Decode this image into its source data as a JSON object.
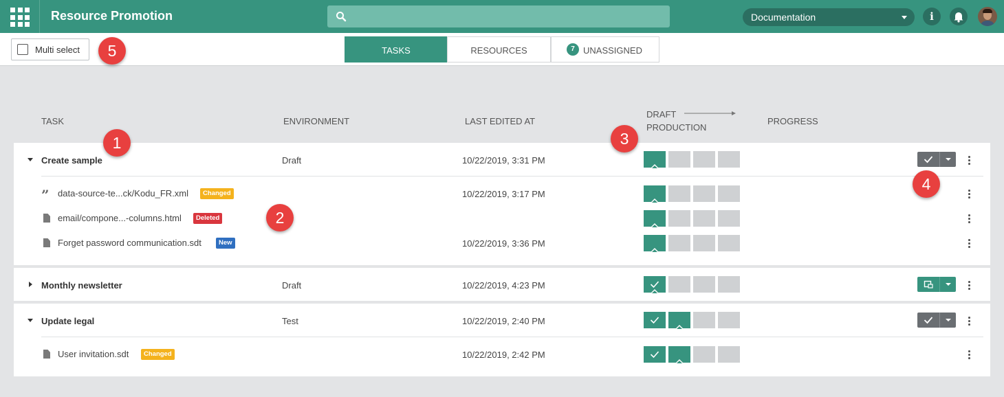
{
  "app": {
    "title": "Resource Promotion"
  },
  "header": {
    "environment_select": "Documentation",
    "info_glyph": "i",
    "icons": [
      "apps-grid-icon",
      "search-icon",
      "info-icon",
      "bell-icon",
      "avatar"
    ]
  },
  "toolbar": {
    "multi_select_label": "Multi select",
    "tabs": [
      {
        "label": "TASKS",
        "active": true
      },
      {
        "label": "RESOURCES",
        "active": false
      },
      {
        "label": "UNASSIGNED",
        "count": "7",
        "active": false
      }
    ]
  },
  "columns": {
    "task": "TASK",
    "environment": "ENVIRONMENT",
    "last_edited": "LAST EDITED AT",
    "stage_from": "DRAFT",
    "stage_to": "PRODUCTION",
    "progress": "PROGRESS"
  },
  "tasks": [
    {
      "name": "Create sample",
      "expanded": true,
      "environment": "Draft",
      "last_edited": "10/22/2019, 3:31 PM",
      "stages": [
        "current",
        "off",
        "off",
        "off"
      ],
      "action": "check-icon",
      "resources": [
        {
          "name": "data-source-te...ck/Kodu_FR.xml",
          "icon": "quote-icon",
          "badge": "Changed",
          "badge_type": "changed",
          "last_edited": "10/22/2019, 3:17 PM",
          "stages": [
            "current",
            "off",
            "off",
            "off"
          ]
        },
        {
          "name": "email/compone...-columns.html",
          "icon": "file-icon",
          "badge": "Deleted",
          "badge_type": "deleted",
          "last_edited": "",
          "stages": [
            "current",
            "off",
            "off",
            "off"
          ]
        },
        {
          "name": "Forget password communication.sdt",
          "icon": "file-icon",
          "badge": "New",
          "badge_type": "new",
          "last_edited": "10/22/2019, 3:36 PM",
          "stages": [
            "current",
            "off",
            "off",
            "off"
          ]
        }
      ]
    },
    {
      "name": "Monthly newsletter",
      "expanded": false,
      "environment": "Draft",
      "last_edited": "10/22/2019, 4:23 PM",
      "stages": [
        "done-current",
        "off",
        "off",
        "off"
      ],
      "action": "promote-icon"
    },
    {
      "name": "Update legal",
      "expanded": true,
      "environment": "Test",
      "last_edited": "10/22/2019, 2:40 PM",
      "stages": [
        "done",
        "current",
        "off",
        "off"
      ],
      "action": "check-icon",
      "resources": [
        {
          "name": "User invitation.sdt",
          "icon": "file-icon",
          "badge": "Changed",
          "badge_type": "changed",
          "last_edited": "10/22/2019, 2:42 PM",
          "stages": [
            "done",
            "current",
            "off",
            "off"
          ]
        }
      ]
    }
  ],
  "markers": [
    "1",
    "2",
    "3",
    "4",
    "5"
  ],
  "colors": {
    "brand": "#37947f",
    "brand_dark": "#2b6f61",
    "changed": "#f4b21d",
    "deleted": "#d9363e",
    "new": "#2f6fc0",
    "marker": "#e8403f"
  }
}
